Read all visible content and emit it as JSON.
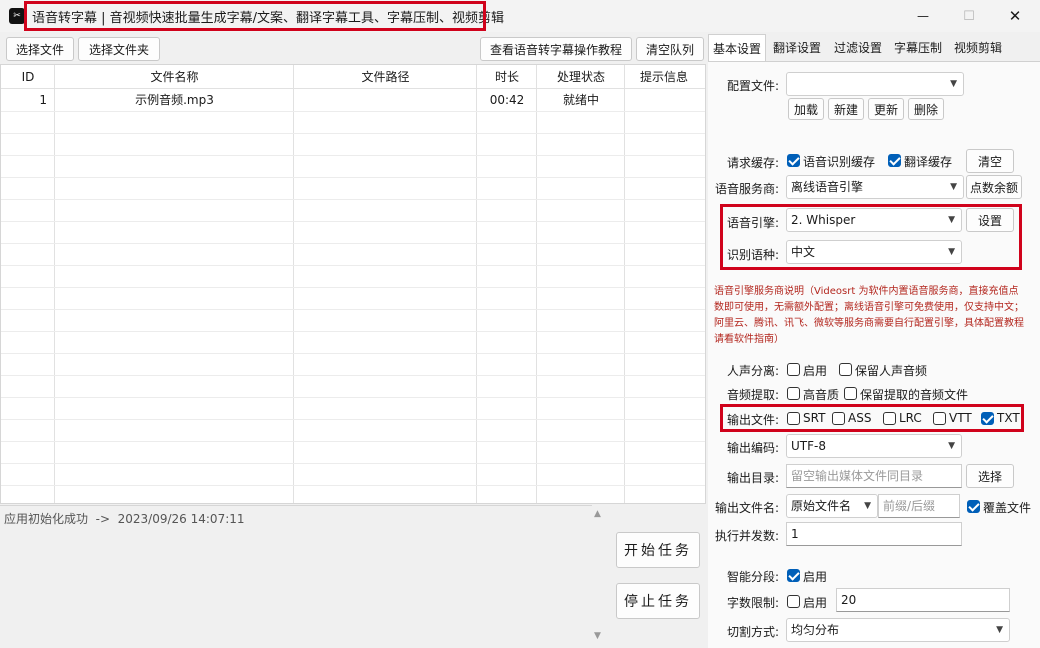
{
  "window": {
    "app_icon": "videosrt-app-icon",
    "title": "语音转字幕 | 音视频快速批量生成字幕/文案、翻译字幕工具、字幕压制、视频剪辑",
    "minimize": "—",
    "maximize": "☐",
    "close": "✕"
  },
  "toolbar": {
    "select_file": "选择文件",
    "select_folder": "选择文件夹",
    "tutorial": "查看语音转字幕操作教程",
    "clear_queue": "清空队列"
  },
  "table": {
    "columns": [
      "ID",
      "文件名称",
      "文件路径",
      "时长",
      "处理状态",
      "提示信息"
    ],
    "rows": [
      {
        "id": "1",
        "name": "示例音频.mp3",
        "path": "",
        "duration": "00:42",
        "status": "就绪中",
        "message": ""
      }
    ]
  },
  "log": {
    "text": "应用初始化成功  ->  2023/09/26 14:07:11",
    "scroll_up": "▲",
    "scroll_down": "▼"
  },
  "actions": {
    "start": "开始任务",
    "stop": "停止任务"
  },
  "tabs": [
    "基本设置",
    "翻译设置",
    "过滤设置",
    "字幕压制",
    "视频剪辑"
  ],
  "settings": {
    "config_file_label": "配置文件:",
    "config_file_value": "",
    "load": "加载",
    "new": "新建",
    "update": "更新",
    "delete": "删除",
    "cache_label": "请求缓存:",
    "cache_asr": "语音识别缓存",
    "cache_translate": "翻译缓存",
    "cache_clear": "清空",
    "provider_label": "语音服务商:",
    "provider_value": "离线语音引擎",
    "recharge": "点数余额",
    "engine_label": "语音引擎:",
    "engine_value": "2. Whisper",
    "engine_setup": "设置",
    "language_label": "识别语种:",
    "language_value": "中文",
    "note": "语音引擎服务商说明（Videosrt 为软件内置语音服务商，直接充值点数即可使用，无需额外配置；离线语音引擎可免费使用，仅支持中文；阿里云、腾讯、讯飞、微软等服务商需要自行配置引擎，具体配置教程请看软件指南）",
    "vocal_label": "人声分离:",
    "vocal_enable": "启用",
    "vocal_keep": "保留人声音频",
    "extract_label": "音频提取:",
    "extract_hq": "高音质",
    "extract_keep": "保留提取的音频文件",
    "output_label": "输出文件:",
    "output_formats": [
      {
        "name": "SRT",
        "checked": false
      },
      {
        "name": "ASS",
        "checked": false
      },
      {
        "name": "LRC",
        "checked": false
      },
      {
        "name": "VTT",
        "checked": false
      },
      {
        "name": "TXT",
        "checked": true
      }
    ],
    "encoding_label": "输出编码:",
    "encoding_value": "UTF-8",
    "dir_label": "输出目录:",
    "dir_placeholder": "留空输出媒体文件同目录",
    "dir_choose": "选择",
    "filename_label": "输出文件名:",
    "filename_value": "原始文件名",
    "affix_placeholder": "前缀/后缀",
    "overwrite": "覆盖文件",
    "concurrency_label": "执行并发数:",
    "concurrency_value": "1",
    "smart_label": "智能分段:",
    "smart_enable": "启用",
    "limit_label": "字数限制:",
    "limit_enable": "启用",
    "limit_value": "20",
    "split_label": "切割方式:",
    "split_value": "均匀分布"
  },
  "colors": {
    "highlight_box": "#d0021b",
    "checkbox_on": "#005fb8",
    "note_text": "#b3261e"
  }
}
